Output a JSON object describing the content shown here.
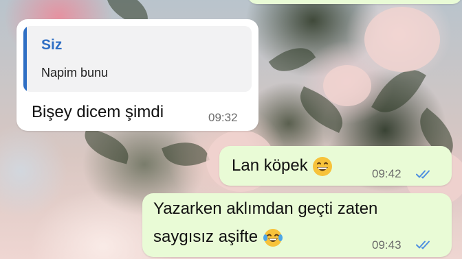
{
  "messages": [
    {
      "direction": "incoming",
      "quoted": {
        "author": "Siz",
        "text": "Napim bunu"
      },
      "text": "Bişey dicem şimdi",
      "time": "09:32"
    },
    {
      "direction": "outgoing",
      "text": "Lan köpek",
      "emoji": "grinning-face-icon",
      "time": "09:42",
      "status": "read"
    },
    {
      "direction": "outgoing",
      "lines": [
        "Yazarken aklımdan geçti zaten",
        "saygısız aşifte"
      ],
      "emoji": "tears-of-joy-face-icon",
      "time": "09:43",
      "status": "read"
    }
  ],
  "colors": {
    "incoming_bubble": "#ffffff",
    "outgoing_bubble": "#e9fbd6",
    "quote_accent": "#2f6fc4",
    "read_ticks": "#4f8fe0",
    "timestamp": "#6b6b6b"
  }
}
